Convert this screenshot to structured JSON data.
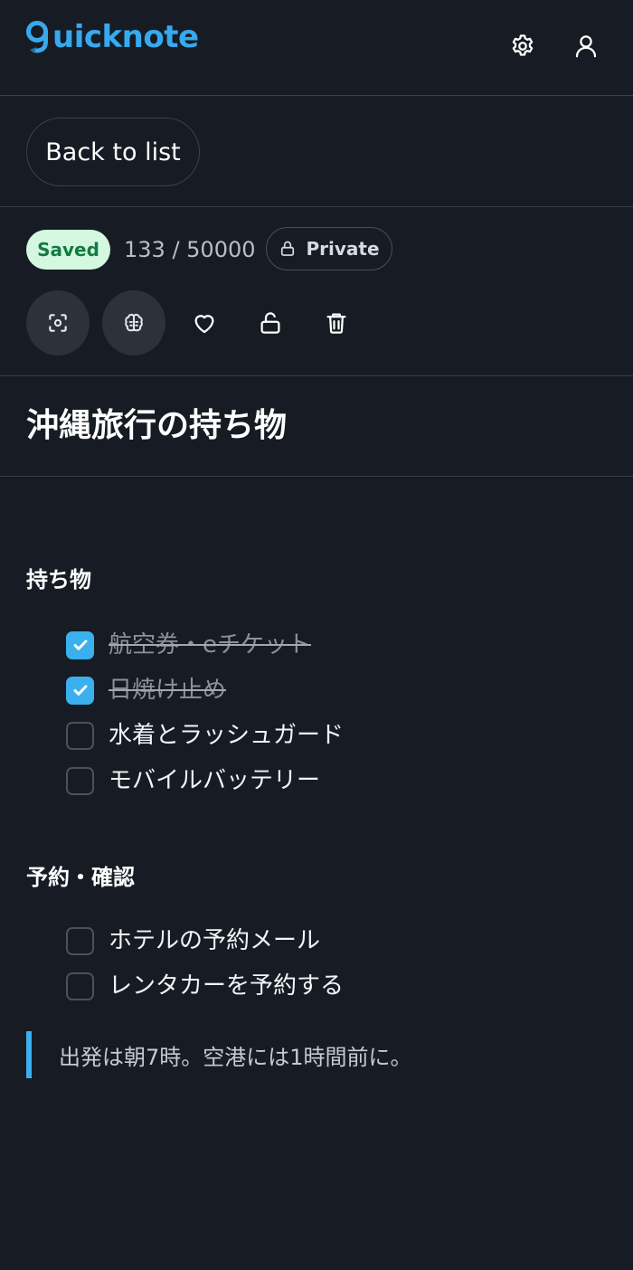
{
  "header": {
    "logo_text": "uicknote",
    "settings_icon": "gear-icon",
    "account_icon": "user-icon"
  },
  "nav": {
    "back_label": "Back to list"
  },
  "toolbar": {
    "save_status": "Saved",
    "char_count": "133 / 50000",
    "privacy_label": "Private",
    "tools": [
      "focus-icon",
      "brain-icon",
      "heart-icon",
      "unlock-icon",
      "trash-icon"
    ]
  },
  "note": {
    "title": "沖縄旅行の持ち物",
    "sections": [
      {
        "heading": "持ち物",
        "items": [
          {
            "text": "航空券・eチケット",
            "checked": true
          },
          {
            "text": "日焼け止め",
            "checked": true
          },
          {
            "text": "水着とラッシュガード",
            "checked": false
          },
          {
            "text": "モバイルバッテリー",
            "checked": false
          }
        ]
      },
      {
        "heading": "予約・確認",
        "items": [
          {
            "text": "ホテルの予約メール",
            "checked": false
          },
          {
            "text": "レンタカーを予約する",
            "checked": false
          }
        ]
      }
    ],
    "quote": "出発は朝7時。空港には1時間前に。"
  },
  "colors": {
    "background": "#171c24",
    "accent": "#3ab0ee",
    "saved_bg": "#d3f8df",
    "saved_text": "#137a44",
    "divider": "#3a3f47"
  }
}
